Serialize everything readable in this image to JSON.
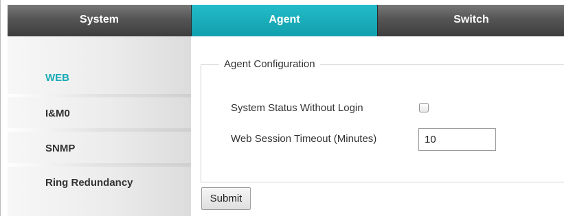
{
  "tabs": {
    "system": "System",
    "agent": "Agent",
    "switch": "Switch",
    "active": "Agent"
  },
  "sidebar": {
    "items": [
      {
        "label": "WEB",
        "active": true
      },
      {
        "label": "I&M0",
        "active": false
      },
      {
        "label": "SNMP",
        "active": false
      },
      {
        "label": "Ring Redundancy",
        "active": false
      }
    ]
  },
  "agent_config": {
    "legend": "Agent Configuration",
    "status_without_login_label": "System Status Without Login",
    "status_without_login_checked": false,
    "session_timeout_label": "Web Session Timeout (Minutes)",
    "session_timeout_value": "10"
  },
  "actions": {
    "submit_label": "Submit"
  },
  "colors": {
    "accent": "#17a9b5",
    "tab_dark": "#4a4a4a"
  }
}
